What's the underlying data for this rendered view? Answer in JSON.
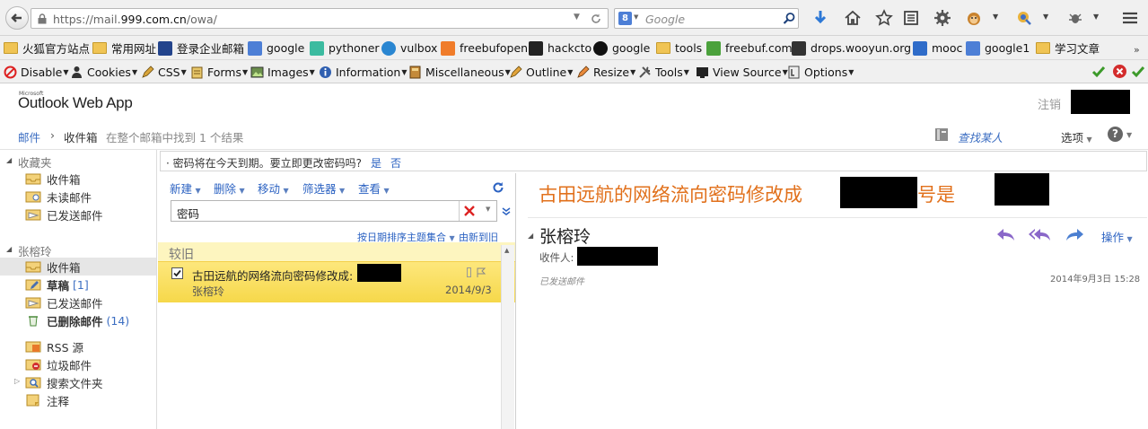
{
  "browser": {
    "url_prefix": "https://mail.",
    "url_domain": "999.com.cn",
    "url_suffix": "/owa/",
    "search_placeholder": "Google",
    "bookmarks": [
      "火狐官方站点",
      "常用网址",
      "登录企业邮箱",
      "google",
      "pythoner",
      "vulbox",
      "freebufopen",
      "hackcto",
      "google",
      "tools",
      "freebuf.com",
      "drops.wooyun.org",
      "mooc",
      "google1",
      "学习文章"
    ],
    "webdev": [
      "Disable",
      "Cookies",
      "CSS",
      "Forms",
      "Images",
      "Information",
      "Miscellaneous",
      "Outline",
      "Resize",
      "Tools",
      "View Source",
      "Options"
    ]
  },
  "owa": {
    "brand_small": "Microsoft",
    "brand": "Outlook Web App",
    "signout": "注销",
    "breadcrumb": {
      "root": "邮件",
      "sep": "›",
      "folder": "收件箱",
      "result": "在整个邮箱中找到 1 个结果"
    },
    "find_someone": "查找某人",
    "options": "选项",
    "help": "?",
    "infobar": {
      "text": "· 密码将在今天到期。要立即更改密码吗?",
      "yes": "是",
      "no": "否"
    }
  },
  "nav": {
    "favorites": {
      "title": "收藏夹",
      "items": [
        "收件箱",
        "未读邮件",
        "已发送邮件"
      ]
    },
    "mailbox": {
      "title": "张榕玲",
      "items": [
        {
          "label": "收件箱",
          "count": ""
        },
        {
          "label": "草稿",
          "count": "[1]"
        },
        {
          "label": "已发送邮件",
          "count": ""
        },
        {
          "label": "已删除邮件",
          "count": "(14)"
        },
        {
          "label": "RSS 源",
          "count": ""
        },
        {
          "label": "垃圾邮件",
          "count": ""
        },
        {
          "label": "搜索文件夹",
          "count": ""
        },
        {
          "label": "注释",
          "count": ""
        }
      ]
    }
  },
  "list": {
    "commands": [
      "新建",
      "删除",
      "移动",
      "筛选器",
      "查看"
    ],
    "search_value": "密码",
    "sort_by": "按日期排序主题集合",
    "order": "由新到旧",
    "group": "较旧",
    "message": {
      "subject": "古田远航的网络流向密码修改成:",
      "from": "张榕玲",
      "date": "2014/9/3"
    }
  },
  "reading": {
    "subject_a": "古田远航的网络流向密码修改成",
    "subject_b": "，账号是",
    "sender": "张榕玲",
    "to_label": "收件人:",
    "actions_label": "操作",
    "folder": "已发送邮件",
    "datetime": "2014年9月3日 15:28"
  },
  "colors": {
    "accent": "#2b62c2",
    "subject": "#e1701b",
    "selection": "#f6d84a"
  }
}
